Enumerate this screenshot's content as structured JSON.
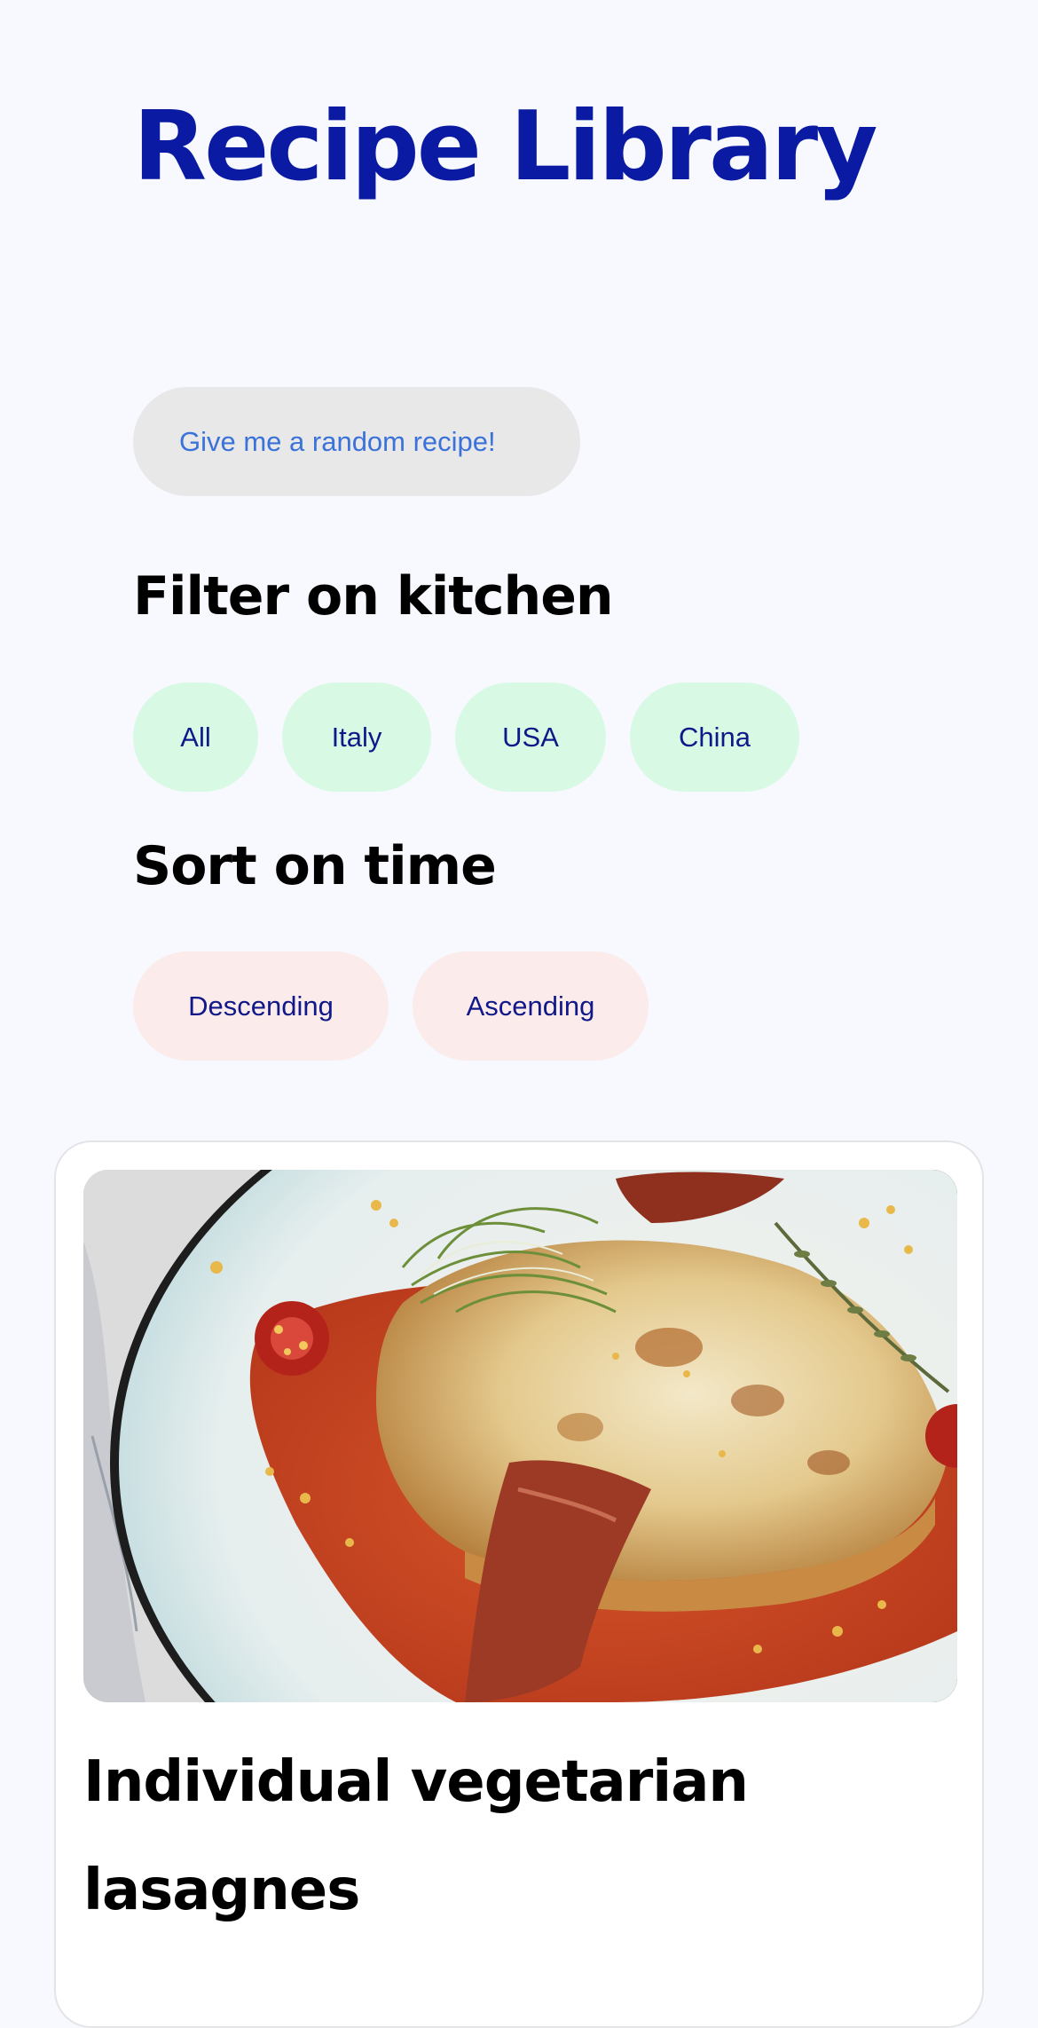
{
  "header": {
    "title": "Recipe Library"
  },
  "actions": {
    "random_label": "Give me a random recipe!"
  },
  "filter": {
    "heading": "Filter on kitchen",
    "options": [
      "All",
      "Italy",
      "USA",
      "China"
    ]
  },
  "sort": {
    "heading": "Sort on time",
    "options": [
      "Descending",
      "Ascending"
    ]
  },
  "recipes": [
    {
      "title": "Individual vegetarian lasagnes",
      "image_icon": "lasagne-photo"
    }
  ],
  "colors": {
    "title": "#0a1aa3",
    "random_button_bg": "#e8e8e8",
    "random_button_text": "#3b72d9",
    "filter_chip_bg": "#d8fae4",
    "sort_chip_bg": "#fbebea",
    "chip_text": "#11198a",
    "page_bg": "#f8f9fe"
  }
}
